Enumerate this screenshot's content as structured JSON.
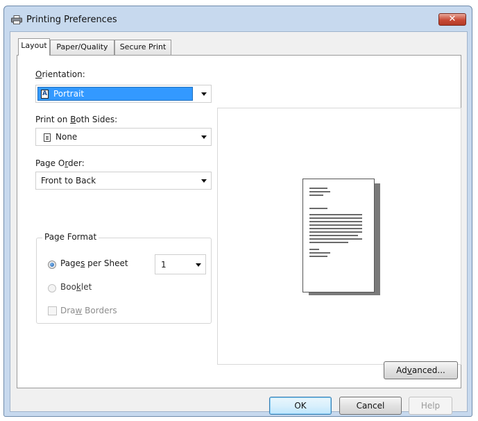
{
  "window": {
    "title": "Printing Preferences",
    "close_glyph": "✕"
  },
  "tabs": [
    {
      "label": "Layout",
      "active": true
    },
    {
      "label": "Paper/Quality",
      "active": false
    },
    {
      "label": "Secure Print",
      "active": false
    }
  ],
  "orientation": {
    "label_pre": "",
    "label_key": "O",
    "label_post": "rientation:",
    "value": "Portrait",
    "icon": "portrait-orientation-icon"
  },
  "both_sides": {
    "label_pre": "Print on ",
    "label_key": "B",
    "label_post": "oth Sides:",
    "value": "None",
    "icon": "document-icon"
  },
  "page_order": {
    "label_pre": "Page O",
    "label_key": "r",
    "label_post": "der:",
    "value": "Front to Back"
  },
  "page_format": {
    "legend": "Page Format",
    "pages_per_sheet": {
      "label_pre": "Page",
      "label_key": "s",
      "label_post": " per Sheet",
      "selected": true,
      "value": "1"
    },
    "booklet": {
      "label_pre": "Boo",
      "label_key": "k",
      "label_post": "let",
      "selected": false,
      "enabled": false
    },
    "draw_borders": {
      "label_pre": "Dra",
      "label_key": "w",
      "label_post": " Borders",
      "checked": false,
      "enabled": false
    }
  },
  "buttons": {
    "advanced": {
      "label_pre": "Ad",
      "label_key": "v",
      "label_post": "anced..."
    },
    "ok": "OK",
    "cancel": "Cancel",
    "help": "Help"
  },
  "colors": {
    "selection": "#3399ff",
    "title_bar": "#c7d9ee",
    "close_button": "#c84a36"
  }
}
